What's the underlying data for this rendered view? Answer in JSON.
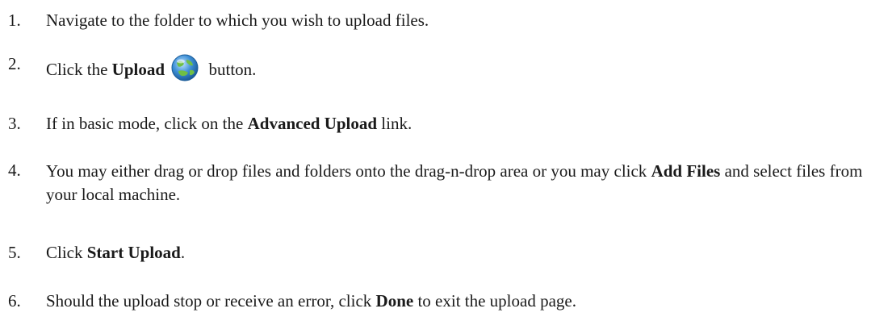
{
  "steps": [
    {
      "number": "1.",
      "text": "Navigate to the folder to which you wish to upload files."
    },
    {
      "number": "2.",
      "pre": "Click the ",
      "bold": "Upload",
      "icon": "upload-globe-icon",
      "post": " button."
    },
    {
      "number": "3.",
      "pre": "If in basic mode, click on the ",
      "bold": "Advanced Upload",
      "post": " link."
    },
    {
      "number": "4.",
      "pre": "You may either drag or drop files and folders onto the drag-n-drop area or you may click ",
      "bold": "Add Files",
      "post": " and select files from your local machine."
    },
    {
      "number": "5.",
      "pre": "Click ",
      "bold": "Start Upload",
      "post": "."
    },
    {
      "number": "6.",
      "pre": "Should the upload stop or receive an error, click ",
      "bold": "Done",
      "post": " to exit the upload page."
    }
  ],
  "colors": {
    "text": "#1a1a1a",
    "icon_blue": "#2f7fc4",
    "icon_green": "#5fb832"
  }
}
